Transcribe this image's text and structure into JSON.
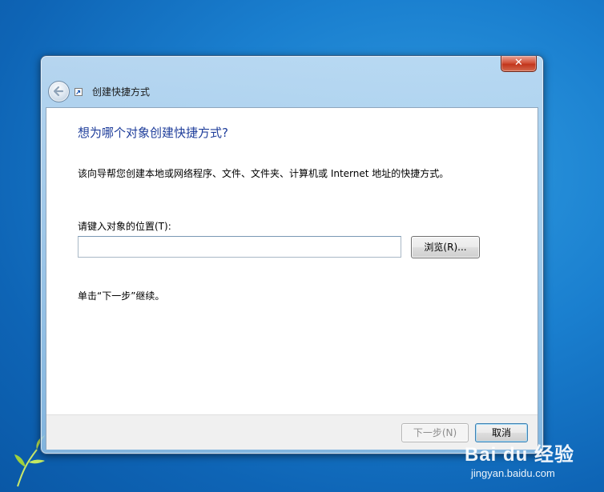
{
  "window": {
    "title": "创建快捷方式",
    "close_symbol": "✕"
  },
  "content": {
    "heading": "想为哪个对象创建快捷方式?",
    "description": "该向导帮您创建本地或网络程序、文件、文件夹、计算机或 Internet 地址的快捷方式。",
    "location_label": "请键入对象的位置(T):",
    "location_value": "",
    "browse_label": "浏览(R)...",
    "hint": "单击“下一步”继续。"
  },
  "footer": {
    "next_label": "下一步(N)",
    "cancel_label": "取消"
  },
  "watermark": {
    "logo_text": "Bai du 经验",
    "url": "jingyan.baidu.com"
  },
  "icons": {
    "back": "back-arrow-icon",
    "shortcut": "shortcut-icon",
    "close": "close-icon"
  },
  "colors": {
    "heading": "#1f3e9b",
    "close_button": "#c2351c",
    "desktop": "#1a7fcf"
  }
}
